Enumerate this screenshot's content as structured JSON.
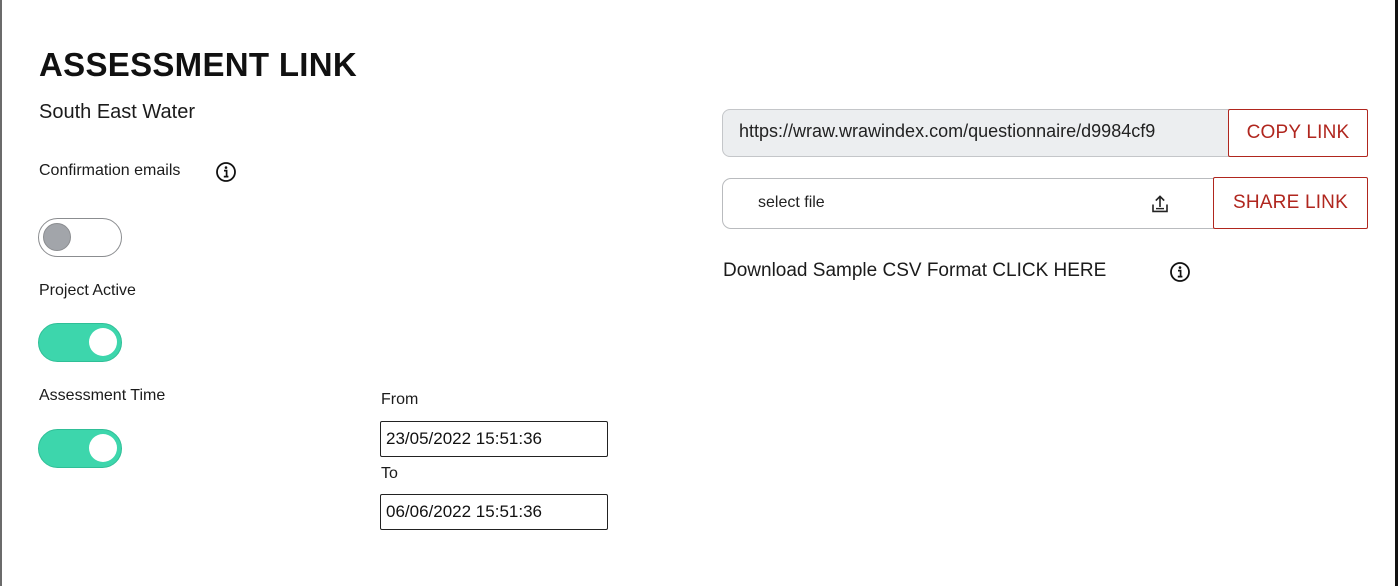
{
  "page": {
    "title": "ASSESSMENT LINK",
    "organization": "South East Water"
  },
  "settings": {
    "confirmation_emails": {
      "label": "Confirmation emails",
      "enabled": false,
      "info_icon": "info-icon"
    },
    "project_active": {
      "label": "Project Active",
      "enabled": true
    },
    "assessment_time": {
      "label": "Assessment Time",
      "enabled": true,
      "from_label": "From",
      "from_value": "23/05/2022 15:51:36",
      "to_label": "To",
      "to_value": "06/06/2022 15:51:36"
    }
  },
  "link_panel": {
    "url": "https://wraw.wrawindex.com/questionnaire/d9984cf9",
    "copy_label": "COPY LINK",
    "file_placeholder": "select file",
    "upload_icon": "upload-icon",
    "share_label": "SHARE LINK",
    "download_text": "Download Sample CSV Format CLICK HERE",
    "info_icon": "info-icon"
  },
  "colors": {
    "toggle_on": "#3dd6ac",
    "toggle_off_knob": "#a2a5aa",
    "accent_red": "#b0261e",
    "url_background": "#eceef0"
  }
}
